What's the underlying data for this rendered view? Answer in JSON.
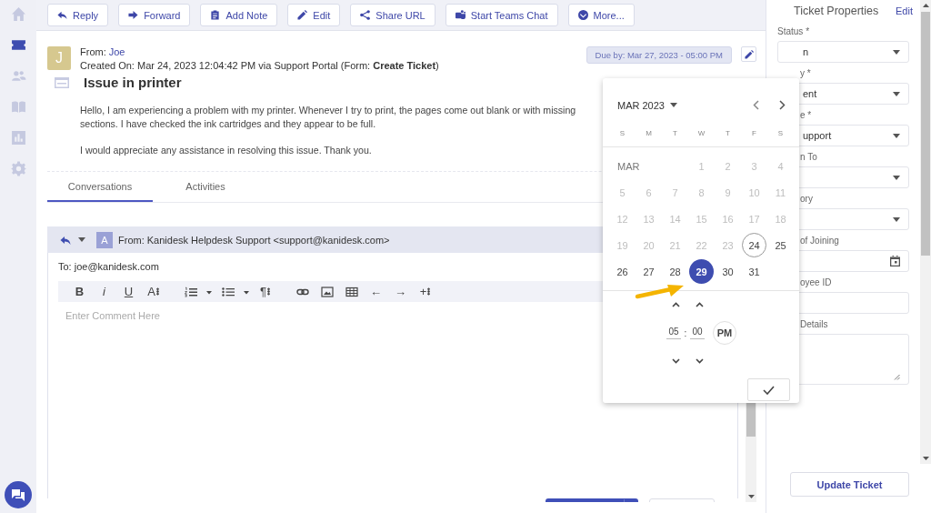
{
  "sidebar": {
    "items": [
      {
        "kind": "home",
        "selected": false
      },
      {
        "kind": "ticket",
        "selected": true
      },
      {
        "kind": "contacts",
        "selected": false
      },
      {
        "kind": "book",
        "selected": false
      },
      {
        "kind": "chart",
        "selected": false
      },
      {
        "kind": "settings",
        "selected": false
      }
    ],
    "chat_button": {
      "kind": "chat"
    }
  },
  "toolbar": {
    "buttons": [
      {
        "kind": "reply",
        "label": "Reply"
      },
      {
        "kind": "forward",
        "label": "Forward"
      },
      {
        "kind": "note",
        "label": "Add Note"
      },
      {
        "kind": "edit",
        "label": "Edit"
      },
      {
        "kind": "share",
        "label": "Share URL"
      },
      {
        "kind": "teams",
        "label": "Start Teams Chat"
      },
      {
        "kind": "more",
        "label": "More..."
      }
    ]
  },
  "ticket": {
    "avatar": "J",
    "from_label": "From:",
    "from_name": "Joe",
    "created": "Created On: Mar 24, 2023 12:04:42 PM via Support Portal (Form: **Create Ticket**)",
    "due": "Due by: Mar 27, 2023 - 05:00 PM",
    "title": "Issue in printer",
    "body": [
      "Hello, I am experiencing a problem with my printer. Whenever I try to print, the pages come out blank or with missing sections. I have checked the ink cartridges and they appear to be full.",
      "I would appreciate any assistance in resolving this issue. Thank you."
    ]
  },
  "tabs": [
    {
      "label": "Conversations",
      "selected": true
    },
    {
      "label": "Activities",
      "selected": false
    }
  ],
  "reply": {
    "avatar": "A",
    "from": "From: Kanidesk Helpdesk Support <support@kanidesk.com>",
    "to": "To: joe@kanidesk.com",
    "placeholder": "Enter Comment Here",
    "tools": [
      {
        "kind": "bold",
        "label": "B"
      },
      {
        "kind": "italic",
        "label": "i"
      },
      {
        "kind": "underline",
        "label": "U"
      },
      {
        "kind": "size",
        "label": "A"
      },
      {
        "kind": "ordered-list"
      },
      {
        "kind": "caret"
      },
      {
        "kind": "bullet-list"
      },
      {
        "kind": "caret"
      },
      {
        "kind": "paragraph",
        "label": "¶"
      },
      {
        "kind": "link"
      },
      {
        "kind": "image"
      },
      {
        "kind": "table"
      },
      {
        "kind": "undo",
        "label": "←"
      },
      {
        "kind": "redo",
        "label": "→"
      },
      {
        "kind": "insert",
        "label": "+"
      }
    ]
  },
  "datepicker": {
    "month": "MAR 2023",
    "weekdays": [
      "S",
      "M",
      "T",
      "W",
      "T",
      "F",
      "S"
    ],
    "month_label": "MAR",
    "weeks": [
      [
        {
          "label": "1",
          "disabled": true,
          "today": false,
          "selected": false
        },
        {
          "label": "2",
          "disabled": true,
          "today": false,
          "selected": false
        },
        {
          "label": "3",
          "disabled": true,
          "today": false,
          "selected": false
        },
        {
          "label": "4",
          "disabled": true,
          "today": false,
          "selected": false
        }
      ],
      [
        {
          "label": "5",
          "disabled": true,
          "today": false,
          "selected": false
        },
        {
          "label": "6",
          "disabled": true,
          "today": false,
          "selected": false
        },
        {
          "label": "7",
          "disabled": true,
          "today": false,
          "selected": false
        },
        {
          "label": "8",
          "disabled": true,
          "today": false,
          "selected": false
        },
        {
          "label": "9",
          "disabled": true,
          "today": false,
          "selected": false
        },
        {
          "label": "10",
          "disabled": true,
          "today": false,
          "selected": false
        },
        {
          "label": "11",
          "disabled": true,
          "today": false,
          "selected": false
        }
      ],
      [
        {
          "label": "12",
          "disabled": true,
          "today": false,
          "selected": false
        },
        {
          "label": "13",
          "disabled": true,
          "today": false,
          "selected": false
        },
        {
          "label": "14",
          "disabled": true,
          "today": false,
          "selected": false
        },
        {
          "label": "15",
          "disabled": true,
          "today": false,
          "selected": false
        },
        {
          "label": "16",
          "disabled": true,
          "today": false,
          "selected": false
        },
        {
          "label": "17",
          "disabled": true,
          "today": false,
          "selected": false
        },
        {
          "label": "18",
          "disabled": true,
          "today": false,
          "selected": false
        }
      ],
      [
        {
          "label": "19",
          "disabled": true,
          "today": false,
          "selected": false
        },
        {
          "label": "20",
          "disabled": true,
          "today": false,
          "selected": false
        },
        {
          "label": "21",
          "disabled": true,
          "today": false,
          "selected": false
        },
        {
          "label": "22",
          "disabled": true,
          "today": false,
          "selected": false
        },
        {
          "label": "23",
          "disabled": true,
          "today": false,
          "selected": false
        },
        {
          "label": "24",
          "disabled": false,
          "today": true,
          "selected": false
        },
        {
          "label": "25",
          "disabled": false,
          "today": false,
          "selected": false
        }
      ],
      [
        {
          "label": "26",
          "disabled": false,
          "today": false,
          "selected": false
        },
        {
          "label": "27",
          "disabled": false,
          "today": false,
          "selected": false
        },
        {
          "label": "28",
          "disabled": false,
          "today": false,
          "selected": false
        },
        {
          "label": "29",
          "disabled": false,
          "today": false,
          "selected": true
        },
        {
          "label": "30",
          "disabled": false,
          "today": false,
          "selected": false
        },
        {
          "label": "31",
          "disabled": false,
          "today": false,
          "selected": false
        }
      ]
    ],
    "hour": "05",
    "separator": ":",
    "minute": "00",
    "meridiem": "PM"
  },
  "properties": {
    "title": "Ticket Properties",
    "edit": "Edit",
    "fields": [
      {
        "kind": "select",
        "label": "Status *",
        "value": "n",
        "covered": false
      },
      {
        "kind": "select",
        "label": "y *",
        "value": "ent",
        "covered": true
      },
      {
        "kind": "select",
        "label": "e *",
        "value": "upport",
        "covered": true
      },
      {
        "kind": "select",
        "label": "n To",
        "covered": true
      },
      {
        "kind": "select",
        "label": "ory",
        "covered": true
      },
      {
        "kind": "date",
        "label": "of Joining",
        "covered": true
      },
      {
        "kind": "text",
        "label": "oyee ID",
        "covered": true
      },
      {
        "kind": "textarea",
        "label": "Details",
        "covered": true
      }
    ],
    "button": "Update Ticket"
  }
}
